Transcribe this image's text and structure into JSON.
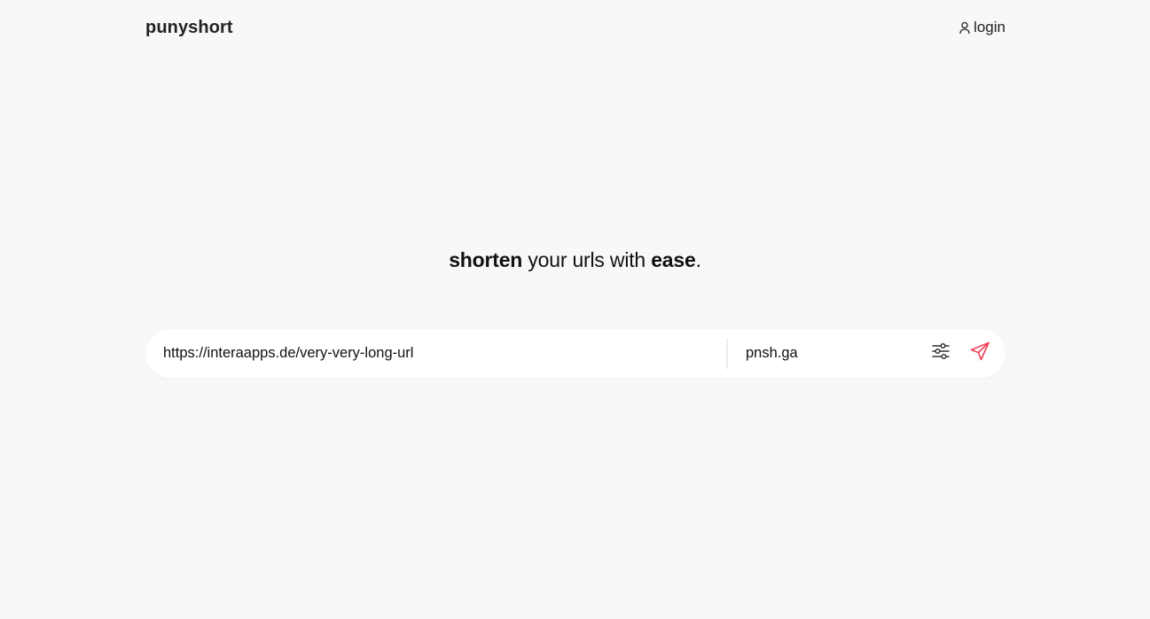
{
  "header": {
    "logo": "punyshort",
    "login_label": "login",
    "login_icon": "user-icon"
  },
  "hero": {
    "word1": "shorten",
    "middle": " your urls with ",
    "word2": "ease",
    "end": "."
  },
  "shortener": {
    "url_value": "https://interaapps.de/very-very-long-url",
    "domain_value": "pnsh.ga",
    "settings_icon": "sliders-icon",
    "submit_icon": "send-icon"
  },
  "colors": {
    "background": "#f8f8f8",
    "accent": "#f0455b",
    "text": "#111111"
  }
}
